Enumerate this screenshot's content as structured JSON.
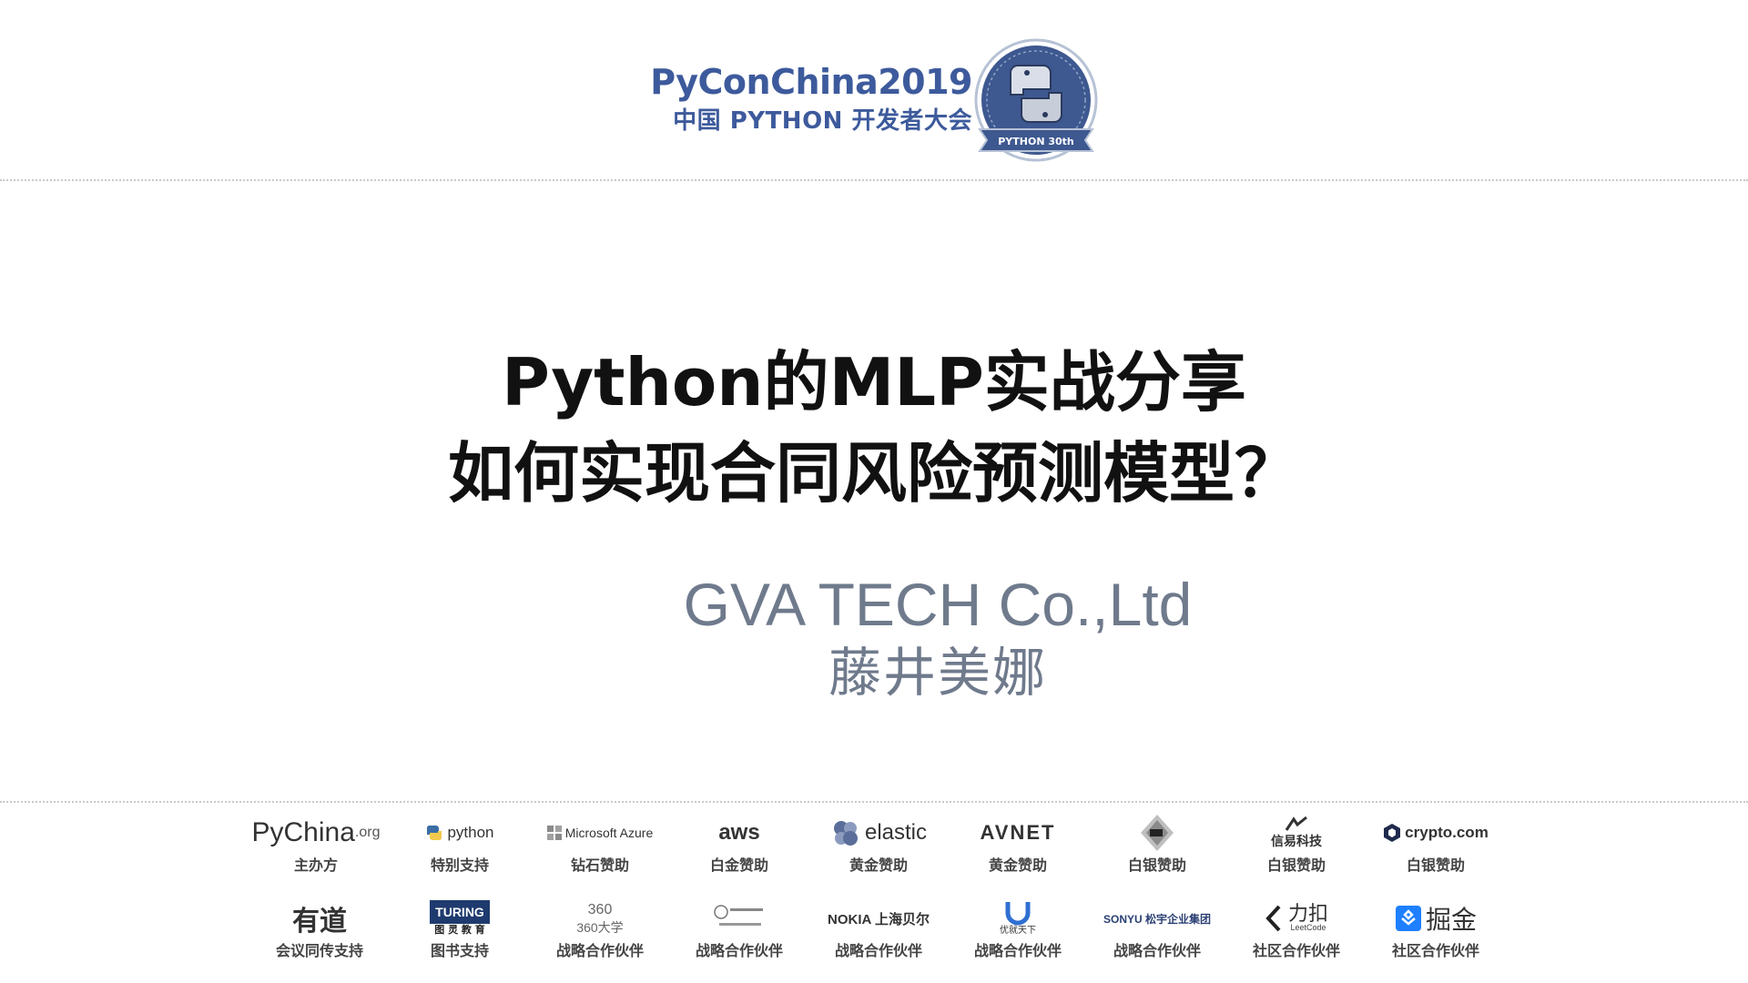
{
  "header": {
    "brand_title": "PyConChina2019",
    "brand_subtitle": "中国 PYTHON 开发者大会",
    "badge_label": "PYTHON 30th"
  },
  "title": {
    "line1": "Python的MLP实战分享",
    "line2": "如何实现合同风险预测模型？"
  },
  "presenter": {
    "company": "GVA TECH Co.,Ltd",
    "name": "藤井美娜"
  },
  "sponsors": {
    "row1": [
      {
        "logo_text": "PyChina",
        "logo_suffix": ".org",
        "role": "主办方"
      },
      {
        "logo_text": "python",
        "role": "特别支持"
      },
      {
        "logo_text": "Microsoft Azure",
        "role": "钻石赞助"
      },
      {
        "logo_text": "aws",
        "role": "白金赞助"
      },
      {
        "logo_text": "elastic",
        "role": "黄金赞助"
      },
      {
        "logo_text": "AVNET",
        "role": "黄金赞助"
      },
      {
        "logo_text": "",
        "role": "白银赞助"
      },
      {
        "logo_text": "信易科技",
        "role": "白银赞助"
      },
      {
        "logo_text": "crypto.com",
        "role": "白银赞助"
      }
    ],
    "row2": [
      {
        "logo_text": "有道",
        "role": "会议同传支持"
      },
      {
        "logo_text": "TURING",
        "logo_sub": "图 灵 教 育",
        "role": "图书支持"
      },
      {
        "logo_text": "360",
        "logo_sub": "360大学",
        "role": "战略合作伙伴"
      },
      {
        "logo_text": "",
        "role": "战略合作伙伴"
      },
      {
        "logo_text": "NOKIA 上海贝尔",
        "role": "战略合作伙伴"
      },
      {
        "logo_text": "优就天下",
        "role": "战略合作伙伴"
      },
      {
        "logo_text": "SONYU 松宇企业集团",
        "role": "战略合作伙伴"
      },
      {
        "logo_text": "力扣",
        "logo_sub": "LeetCode",
        "role": "社区合作伙伴"
      },
      {
        "logo_text": "掘金",
        "role": "社区合作伙伴"
      }
    ]
  },
  "colors": {
    "brand": "#3d5a9c",
    "title": "#111111",
    "presenter": "#6f7a8c",
    "divider": "#c9c9c9"
  }
}
